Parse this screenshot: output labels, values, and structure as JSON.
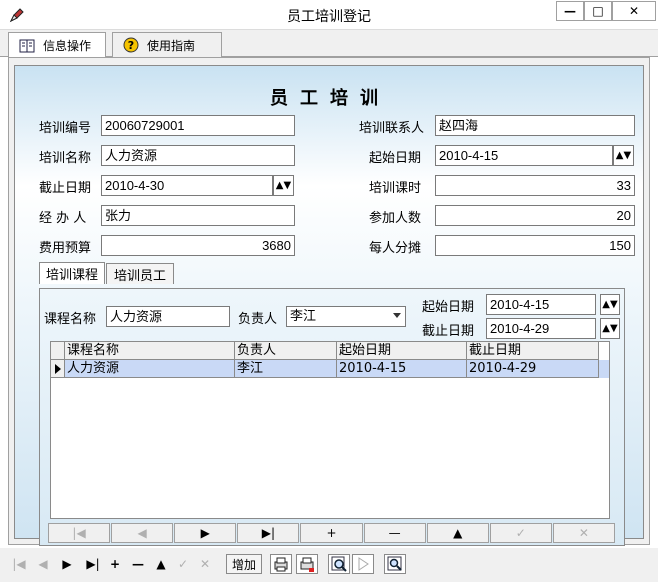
{
  "window": {
    "title": "员工培训登记",
    "min_label": "—",
    "max_label": "□",
    "close_label": "✕"
  },
  "menu": {
    "tabs": [
      {
        "label": "信息操作",
        "icon": "book-icon"
      },
      {
        "label": "使用指南",
        "icon": "help-icon"
      }
    ]
  },
  "form": {
    "title": "员工培训",
    "fields": {
      "training_no": {
        "label": "培训编号",
        "value": "20060729001"
      },
      "contact": {
        "label": "培训联系人",
        "value": "赵四海"
      },
      "training_name": {
        "label": "培训名称",
        "value": "人力资源"
      },
      "start_date": {
        "label": "起始日期",
        "value": "2010-4-15"
      },
      "end_date": {
        "label": "截止日期",
        "value": "2010-4-30"
      },
      "hours": {
        "label": "培训课时",
        "value": "33"
      },
      "handler": {
        "label": "经 办 人",
        "value": "张力"
      },
      "participants": {
        "label": "参加人数",
        "value": "20"
      },
      "budget": {
        "label": "费用预算",
        "value": "3680"
      },
      "per_person": {
        "label": "每人分摊",
        "value": "150"
      }
    },
    "spin_symbol": "▲▼"
  },
  "subtabs": [
    {
      "label": "培训课程",
      "active": true
    },
    {
      "label": "培训员工",
      "active": false
    }
  ],
  "course": {
    "name_label": "课程名称",
    "name_value": "人力资源",
    "owner_label": "负责人",
    "owner_value": "李江",
    "start_label": "起始日期",
    "start_value": "2010-4-15",
    "end_label": "截止日期",
    "end_value": "2010-4-29"
  },
  "grid": {
    "columns": [
      "课程名称",
      "负责人",
      "起始日期",
      "截止日期"
    ],
    "rows": [
      [
        "人力资源",
        "李江",
        "2010-4-15",
        "2010-4-29"
      ]
    ]
  },
  "navigator": {
    "buttons": [
      "|◀",
      "◀",
      "▶",
      "▶|",
      "+",
      "—",
      "▲",
      "✓",
      "✕"
    ]
  },
  "toolbar": {
    "nav_buttons": [
      "|◀",
      "◀",
      "▶",
      "▶|",
      "+",
      "—",
      "▲",
      "✓",
      "✕"
    ],
    "add_label": "增加"
  }
}
